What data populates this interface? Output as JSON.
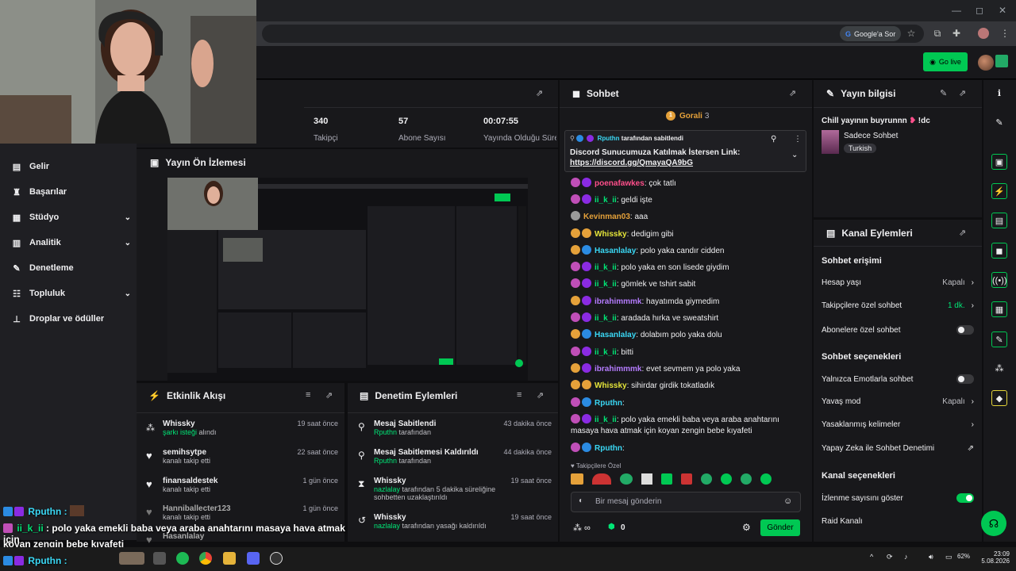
{
  "browser": {
    "google_sor": "Google'a Sor",
    "go_live": "Go live"
  },
  "sidebar": {
    "items": [
      {
        "label": "Gelir",
        "icon": "revenue-icon"
      },
      {
        "label": "Başarılar",
        "icon": "trophy-icon"
      },
      {
        "label": "Stüdyo",
        "icon": "studio-icon",
        "expandable": true
      },
      {
        "label": "Analitik",
        "icon": "analytics-icon",
        "expandable": true
      },
      {
        "label": "Denetleme",
        "icon": "wrench-icon"
      },
      {
        "label": "Topluluk",
        "icon": "community-icon",
        "expandable": true
      },
      {
        "label": "Droplar ve ödüller",
        "icon": "drops-icon"
      }
    ]
  },
  "stats": [
    {
      "value": "340",
      "label": "Takipçi"
    },
    {
      "value": "57",
      "label": "Abone Sayısı"
    },
    {
      "value": "00:07:55",
      "label": "Yayında Olduğu Süre"
    }
  ],
  "preview": {
    "title": "Yayın Ön İzlemesi"
  },
  "activity": {
    "title": "Etkinlik Akışı",
    "items": [
      {
        "name": "Whissky",
        "sub_highlight": "şarkı isteği",
        "sub": " alındı",
        "time": "19 saat önce",
        "icon": "channel-points-icon"
      },
      {
        "name": "semihsytpe",
        "sub_highlight": "",
        "sub": "kanalı takip etti",
        "time": "22 saat önce",
        "icon": "heart-icon"
      },
      {
        "name": "finansaldestek",
        "sub_highlight": "",
        "sub": "kanalı takip etti",
        "time": "1 gün önce",
        "icon": "heart-icon"
      },
      {
        "name": "Hanniballecter123",
        "sub_highlight": "",
        "sub": "kanalı takip etti",
        "time": "1 gün önce",
        "icon": "heart-icon"
      },
      {
        "name": "Hasanlalay",
        "sub_highlight": "",
        "sub": "",
        "time": "",
        "icon": "heart-icon"
      }
    ]
  },
  "moderation": {
    "title": "Denetim Eylemleri",
    "items": [
      {
        "title": "Mesaj Sabitlendi",
        "by": "Rputhn",
        "sub": " tarafından",
        "time": "43 dakika önce",
        "icon": "pin-icon"
      },
      {
        "title": "Mesaj Sabitlemesi Kaldırıldı",
        "by": "Rputhn",
        "sub": " tarafından",
        "time": "44 dakika önce",
        "icon": "unpin-icon"
      },
      {
        "title": "Whissky",
        "by": "nazlalay",
        "sub": " tarafından 5 dakika süreliğine sohbetten uzaklaştırıldı",
        "time": "19 saat önce",
        "icon": "timeout-icon"
      },
      {
        "title": "Whissky",
        "by": "nazlalay",
        "sub": " tarafından yasağı kaldırıldı",
        "time": "19 saat önce",
        "icon": "unban-icon"
      }
    ]
  },
  "chat": {
    "title": "Sohbet",
    "top_gifter": "Gorali",
    "top_gifter_count": "3",
    "pinned_by": "Rputhn",
    "pinned_suffix": " tarafından sabitlendi",
    "pinned_text": "Discord Sunucumuza Katılmak İstersen Link:",
    "pinned_link": "https://discord.gg/QmayaQA9bG",
    "messages": [
      {
        "badges": [
          "#c04fb8",
          "#8a2be2"
        ],
        "user": "poenafawkes",
        "color": "#ff4f8b",
        "text": ": çok tatlı"
      },
      {
        "badges": [
          "#c04fb8",
          "#8a2be2"
        ],
        "user": "ii_k_ii",
        "color": "#00e676",
        "text": ": geldi işte"
      },
      {
        "badges": [
          "#9a9a9a"
        ],
        "user": "Kevinman03",
        "color": "#e5a13a",
        "text": ": aaa"
      },
      {
        "badges": [
          "#e5a13a",
          "#e5a13a"
        ],
        "user": "Whissky",
        "color": "#e5e53a",
        "text": ": dedigim gibi"
      },
      {
        "badges": [
          "#e5a13a",
          "#2b8be2"
        ],
        "user": "Hasanlalay",
        "color": "#3ad8f5",
        "text": ": polo yaka candır cidden"
      },
      {
        "badges": [
          "#c04fb8",
          "#8a2be2"
        ],
        "user": "ii_k_ii",
        "color": "#00e676",
        "text": ": polo yaka en son lisede giydim"
      },
      {
        "badges": [
          "#c04fb8",
          "#8a2be2"
        ],
        "user": "ii_k_ii",
        "color": "#00e676",
        "text": ": gömlek ve tshirt sabit"
      },
      {
        "badges": [
          "#e5a13a",
          "#8a2be2"
        ],
        "user": "ibrahimmmk",
        "color": "#b57cff",
        "text": ": hayatımda giymedim"
      },
      {
        "badges": [
          "#c04fb8",
          "#8a2be2"
        ],
        "user": "ii_k_ii",
        "color": "#00e676",
        "text": ": aradada hırka ve sweatshirt"
      },
      {
        "badges": [
          "#e5a13a",
          "#2b8be2"
        ],
        "user": "Hasanlalay",
        "color": "#3ad8f5",
        "text": ": dolabım polo yaka dolu"
      },
      {
        "badges": [
          "#c04fb8",
          "#8a2be2"
        ],
        "user": "ii_k_ii",
        "color": "#00e676",
        "text": ": bitti"
      },
      {
        "badges": [
          "#e5a13a",
          "#8a2be2"
        ],
        "user": "ibrahimmmk",
        "color": "#b57cff",
        "text": ": evet sevmem ya polo yaka"
      },
      {
        "badges": [
          "#e5a13a",
          "#e5a13a"
        ],
        "user": "Whissky",
        "color": "#e5e53a",
        "text": ": sihirdar girdik tokatladık"
      },
      {
        "badges": [
          "#c04fb8",
          "#2b8be2"
        ],
        "user": "Rputhn",
        "color": "#3ad8f5",
        "text": ":"
      },
      {
        "badges": [
          "#c04fb8",
          "#8a2be2"
        ],
        "user": "ii_k_ii",
        "color": "#00e676",
        "text": ": polo yaka emekli baba veya araba anahtarını masaya hava atmak için koyan zengin bebe kıyafeti"
      },
      {
        "badges": [
          "#c04fb8",
          "#2b8be2"
        ],
        "user": "Rputhn",
        "color": "#3ad8f5",
        "text": ":"
      }
    ],
    "followers_only": "Takipçilere Özel",
    "input_placeholder": "Bir mesaj gönderin",
    "points": "0",
    "send_label": "Gönder"
  },
  "stream_info": {
    "title": "Yayın bilgisi",
    "stream_title": "Chill yayının buyrunnn",
    "stream_title_suffix": "!dc",
    "category": "Sadece Sohbet",
    "tag": "Turkish"
  },
  "channel_actions": {
    "title": "Kanal Eylemleri",
    "chat_access": "Sohbet erişimi",
    "account_age": "Hesap yaşı",
    "account_age_val": "Kapalı",
    "followers_chat": "Takipçilere özel sohbet",
    "followers_chat_val": "1 dk.",
    "subs_chat": "Abonelere özel sohbet",
    "chat_options": "Sohbet seçenekleri",
    "emote_only": "Yalnızca Emotlarla sohbet",
    "slow_mode": "Yavaş mod",
    "slow_mode_val": "Kapalı",
    "banned_words": "Yasaklanmış kelimeler",
    "ai_moderation": "Yapay Zeka ile Sohbet Denetimi",
    "channel_options": "Kanal seçenekleri",
    "show_viewers": "İzlenme sayısını göster",
    "raid": "Raid Kanalı",
    "colors": {
      "accent": "#00c853",
      "background": "#18181b"
    }
  },
  "overlay": {
    "line1_user": "Rputhn :",
    "line2_user": "ii_k_ii",
    "line2_text": " : polo yaka emekli baba veya araba anahtarını masaya hava atmak için",
    "line3_text": "koyan zengin bebe kıyafeti",
    "line4_user": "Rputhn :"
  },
  "taskbar": {
    "battery": "62%",
    "time": "23:09",
    "date": "5.08.2026"
  }
}
